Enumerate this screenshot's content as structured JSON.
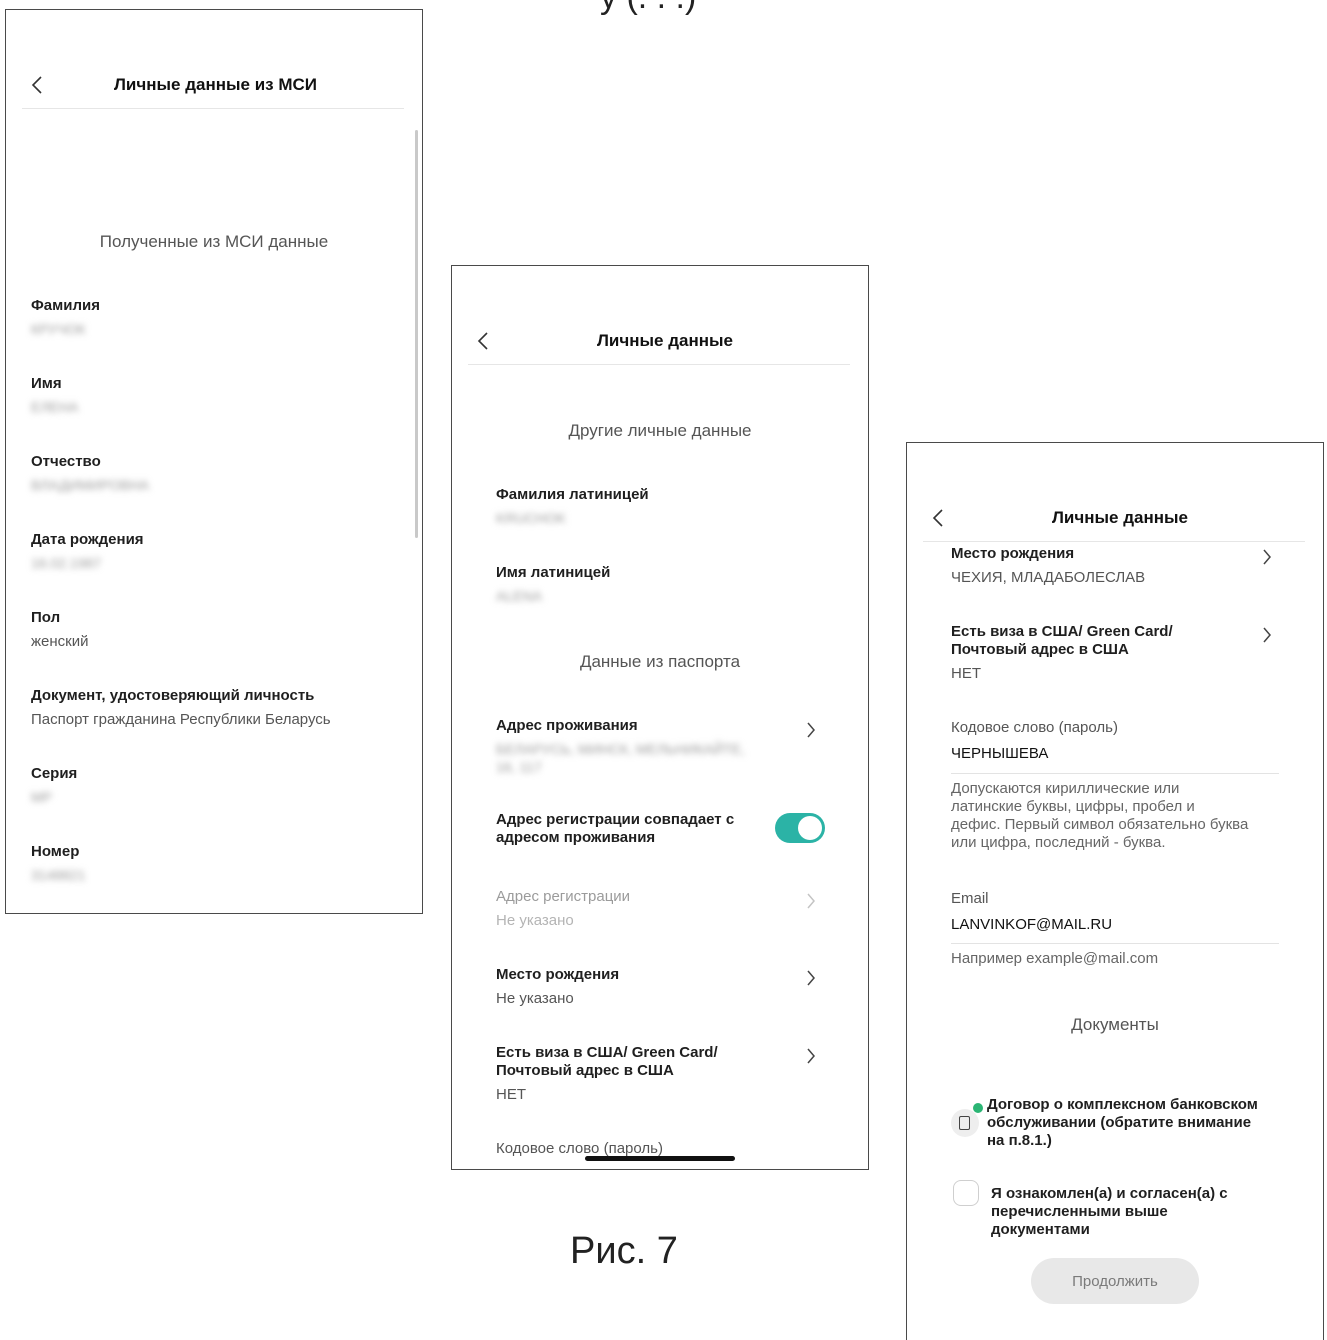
{
  "page_heading": "у (. . .)",
  "caption": "Рис. 7",
  "screen1": {
    "title": "Личные данные из МСИ",
    "section": "Полученные из МСИ данные",
    "fields": [
      {
        "label": "Фамилия",
        "value": "КРУЧОК"
      },
      {
        "label": "Имя",
        "value": "ЕЛЕНА"
      },
      {
        "label": "Отчество",
        "value": "ВЛАДИМИРОВНА"
      },
      {
        "label": "Дата рождения",
        "value": "16.02.1987"
      },
      {
        "label": "Пол",
        "value": "женский"
      },
      {
        "label": "Документ, удостоверяющий личность",
        "value": "Паспорт гражданина Республики Беларусь"
      },
      {
        "label": "Серия",
        "value": "MP"
      },
      {
        "label": "Номер",
        "value": "3148821"
      }
    ]
  },
  "screen2": {
    "title": "Личные данные",
    "section_other": "Другие личные данные",
    "surname_latin_label": "Фамилия латиницей",
    "surname_latin_value": "KRUCHOK",
    "name_latin_label": "Имя латиницей",
    "name_latin_value": "ALENA",
    "section_passport": "Данные из паспорта",
    "residence_label": "Адрес проживания",
    "residence_value_1": "БЕЛАРУСЬ, МИНСК, МЕЛЬНИКАЙТЕ,",
    "residence_value_2": "16, 117",
    "reg_match_label_1": "Адрес регистрации совпадает с",
    "reg_match_label_2": "адресом проживания",
    "reg_match_on": true,
    "reg_address_label": "Адрес регистрации",
    "reg_address_value": "Не указано",
    "birthplace_label": "Место рождения",
    "birthplace_value": "Не указано",
    "visa_label_1": "Есть виза в США/ Green Card/",
    "visa_label_2": "Почтовый адрес в США",
    "visa_value": "НЕТ",
    "codeword_label": "Кодовое слово (пароль)"
  },
  "screen3": {
    "title": "Личные данные",
    "birthplace_label": "Место рождения",
    "birthplace_value": "ЧЕХИЯ, МЛАДАБОЛЕСЛАВ",
    "visa_label_1": "Есть виза в США/ Green Card/",
    "visa_label_2": "Почтовый адрес в США",
    "visa_value": "НЕТ",
    "codeword_label": "Кодовое слово (пароль)",
    "codeword_value": "ЧЕРНЫШЕВА",
    "codeword_hint_1": "Допускаются кириллические или",
    "codeword_hint_2": "латинские буквы, цифры, пробел и",
    "codeword_hint_3": "дефис. Первый символ обязательно буква",
    "codeword_hint_4": "или цифра, последний - буква.",
    "email_label": "Email",
    "email_value": "LANVINKOF@MAIL.RU",
    "email_hint": "Например example@mail.com",
    "documents_title": "Документы",
    "doc_1": "Договор о комплексном банковском",
    "doc_2": "обслуживании (обратите внимание",
    "doc_3": "на п.8.1.)",
    "agree_1": "Я ознакомлен(а) и согласен(а) с",
    "agree_2": "перечисленными выше",
    "agree_3": "документами",
    "continue_label": "Продолжить"
  },
  "colors": {
    "toggle_accent": "#2bb3a6",
    "doc_status_dot": "#2bb574",
    "button_disabled_bg": "#e8e8e8"
  },
  "icons": [
    "back-arrow-icon",
    "chevron-right-icon",
    "document-icon"
  ]
}
